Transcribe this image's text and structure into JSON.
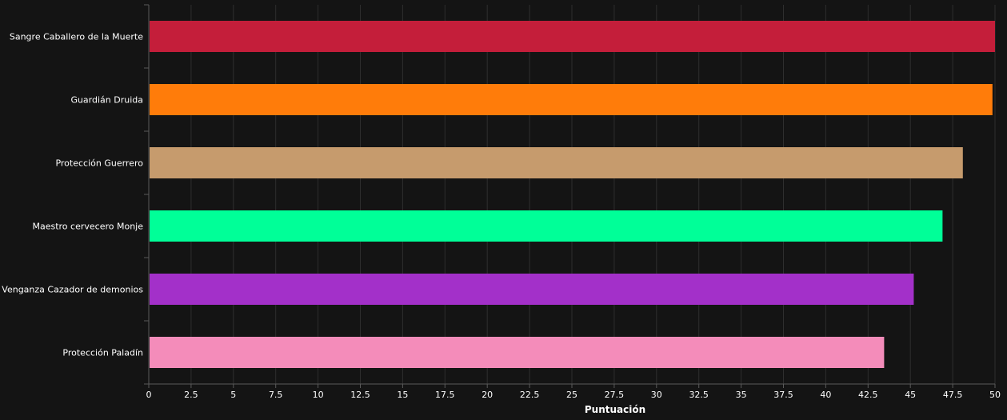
{
  "chart_data": {
    "type": "bar",
    "orientation": "horizontal",
    "categories": [
      "Sangre Caballero de la Muerte",
      "Guardián Druida",
      "Protección Guerrero",
      "Maestro cervecero Monje",
      "Venganza Cazador de demonios",
      "Protección Paladín"
    ],
    "values": [
      50.0,
      49.85,
      48.1,
      46.9,
      45.2,
      43.45
    ],
    "colors": [
      "#c41e3a",
      "#ff7c0a",
      "#c69b6d",
      "#00ff98",
      "#a330c9",
      "#f48cba"
    ],
    "xlabel": "Puntuación",
    "ylabel": "",
    "xlim": [
      0,
      50
    ],
    "xticks": [
      "0",
      "2.5",
      "5",
      "7.5",
      "10",
      "12.5",
      "15",
      "17.5",
      "20",
      "22.5",
      "25",
      "27.5",
      "30",
      "32.5",
      "35",
      "37.5",
      "40",
      "42.5",
      "45",
      "47.5",
      "50"
    ],
    "grid": true
  },
  "theme": {
    "background": "#141414",
    "grid_color": "#2e2e2e",
    "axis_color": "#5a5a5a",
    "text_color": "#ffffff"
  }
}
